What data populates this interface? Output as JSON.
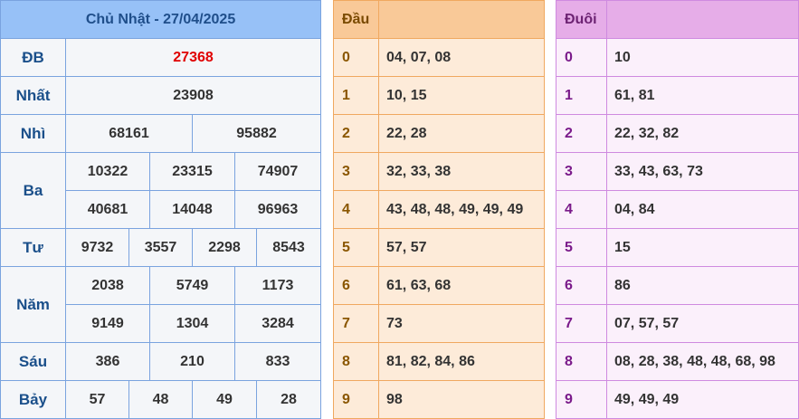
{
  "results": {
    "title": "Chủ Nhật - 27/04/2025",
    "labels": {
      "db": "ĐB",
      "nhat": "Nhất",
      "nhi": "Nhì",
      "ba": "Ba",
      "tu": "Tư",
      "nam": "Năm",
      "sau": "Sáu",
      "bay": "Bảy"
    },
    "db": "27368",
    "nhat": "23908",
    "nhi": [
      "68161",
      "95882"
    ],
    "ba": [
      "10322",
      "23315",
      "74907",
      "40681",
      "14048",
      "96963"
    ],
    "tu": [
      "9732",
      "3557",
      "2298",
      "8543"
    ],
    "nam": [
      "2038",
      "5749",
      "1173",
      "9149",
      "1304",
      "3284"
    ],
    "sau": [
      "386",
      "210",
      "833"
    ],
    "bay": [
      "57",
      "48",
      "49",
      "28"
    ]
  },
  "dau": {
    "header": "Đầu",
    "rows": [
      {
        "k": "0",
        "v": "04, 07, 08"
      },
      {
        "k": "1",
        "v": "10, 15"
      },
      {
        "k": "2",
        "v": "22, 28"
      },
      {
        "k": "3",
        "v": "32, 33, 38"
      },
      {
        "k": "4",
        "v": "43, 48, 48, 49, 49, 49"
      },
      {
        "k": "5",
        "v": "57, 57"
      },
      {
        "k": "6",
        "v": "61, 63, 68"
      },
      {
        "k": "7",
        "v": "73"
      },
      {
        "k": "8",
        "v": "81, 82, 84, 86"
      },
      {
        "k": "9",
        "v": "98"
      }
    ]
  },
  "duoi": {
    "header": "Đuôi",
    "rows": [
      {
        "k": "0",
        "v": "10"
      },
      {
        "k": "1",
        "v": "61, 81"
      },
      {
        "k": "2",
        "v": "22, 32, 82"
      },
      {
        "k": "3",
        "v": "33, 43, 63, 73"
      },
      {
        "k": "4",
        "v": "04, 84"
      },
      {
        "k": "5",
        "v": "15"
      },
      {
        "k": "6",
        "v": "86"
      },
      {
        "k": "7",
        "v": "07, 57, 57"
      },
      {
        "k": "8",
        "v": "08, 28, 38, 48, 48, 68, 98"
      },
      {
        "k": "9",
        "v": "49, 49, 49"
      }
    ]
  }
}
